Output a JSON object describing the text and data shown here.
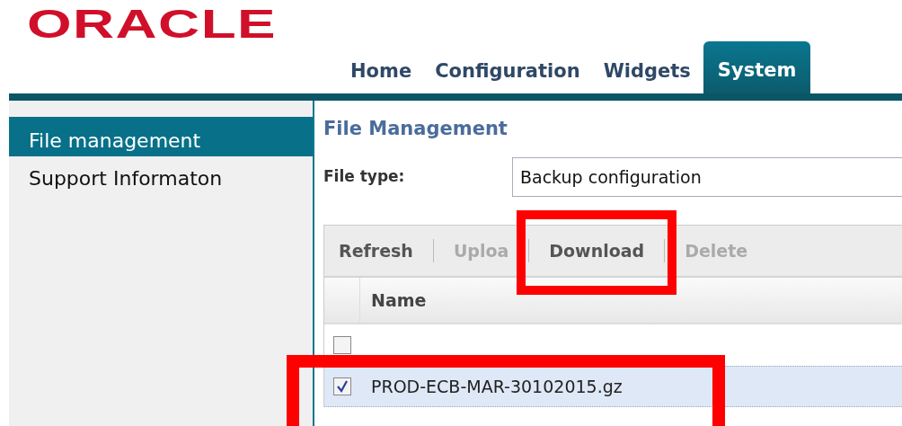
{
  "logo": {
    "text": "ORACLE"
  },
  "tabs": [
    {
      "label": "Home",
      "selected": false
    },
    {
      "label": "Configuration",
      "selected": false
    },
    {
      "label": "Widgets",
      "selected": false
    },
    {
      "label": "System",
      "selected": true
    }
  ],
  "sidebar": {
    "items": [
      {
        "label": "File management",
        "selected": true
      },
      {
        "label": "Support Informaton",
        "selected": false
      }
    ]
  },
  "content": {
    "title": "File Management",
    "file_type": {
      "label": "File type:",
      "value": "Backup configuration"
    },
    "toolbar": [
      {
        "label": "Refresh",
        "disabled": false,
        "highlighted": false
      },
      {
        "label": "Uploa",
        "disabled": true,
        "highlighted": false
      },
      {
        "label": "Download",
        "disabled": false,
        "highlighted": true
      },
      {
        "label": "Delete",
        "disabled": true,
        "highlighted": false
      }
    ],
    "table": {
      "columns": [
        "Name"
      ],
      "rows": [
        {
          "checked": false,
          "selected": false,
          "highlighted": false
        },
        {
          "name": "PROD-ECB-MAR-30102015.gz",
          "checked": true,
          "selected": true,
          "highlighted": true
        }
      ]
    }
  }
}
